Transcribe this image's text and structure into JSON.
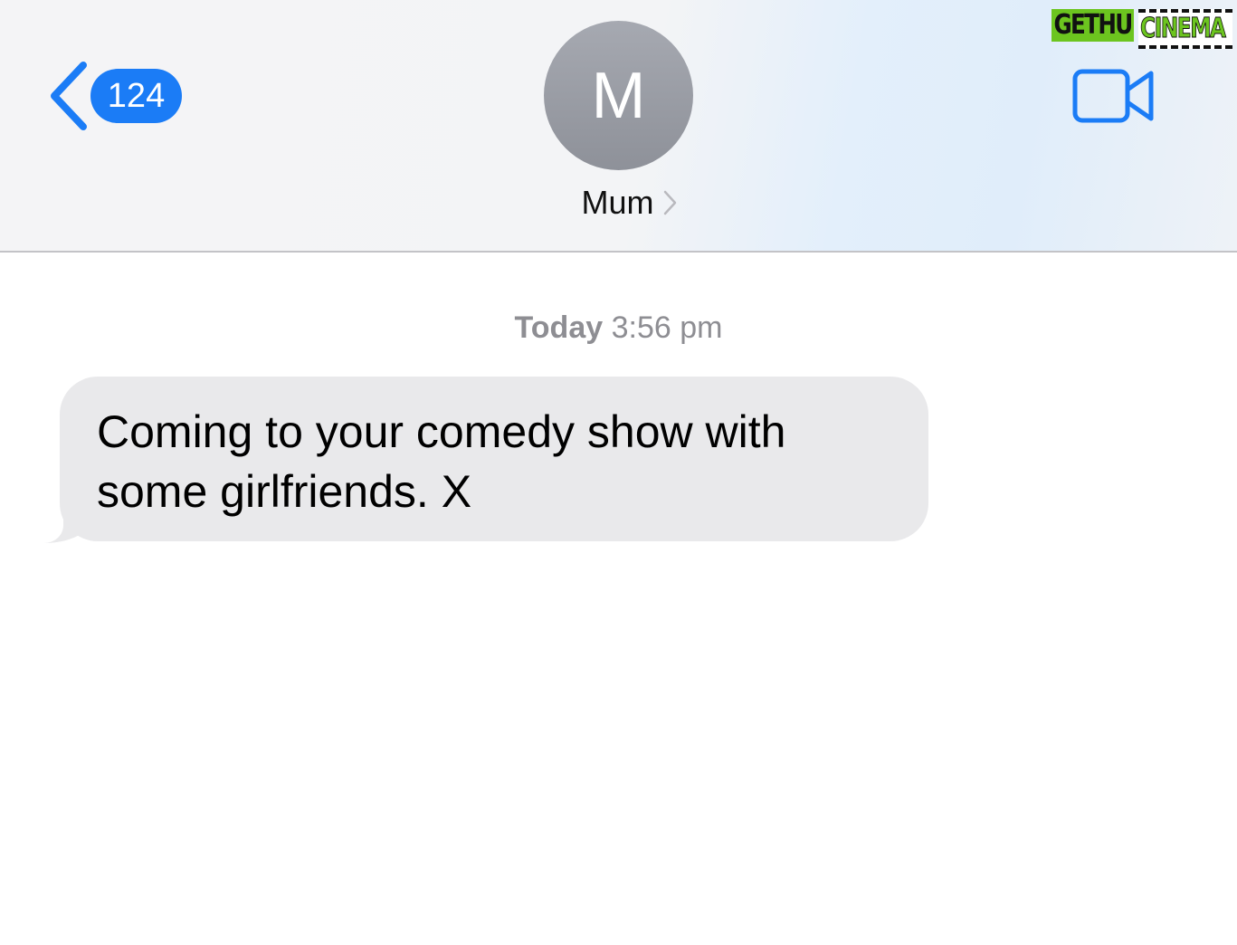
{
  "header": {
    "back_count": "124",
    "avatar_initial": "M",
    "contact_name": "Mum"
  },
  "conversation": {
    "timestamp_day": "Today",
    "timestamp_time": "3:56 pm",
    "messages": [
      {
        "direction": "incoming",
        "line1": "Coming to your comedy show with",
        "line2": "some girlfriends. X"
      }
    ]
  },
  "watermark": {
    "left": "GETHU",
    "right": "CINEMA"
  },
  "colors": {
    "accent": "#1b7cf6",
    "bubble_incoming": "#e9e9eb",
    "timestamp": "#8e8e93"
  },
  "icons": {
    "back": "chevron-left-icon",
    "name_disclosure": "chevron-right-icon",
    "facetime": "video-camera-icon"
  }
}
